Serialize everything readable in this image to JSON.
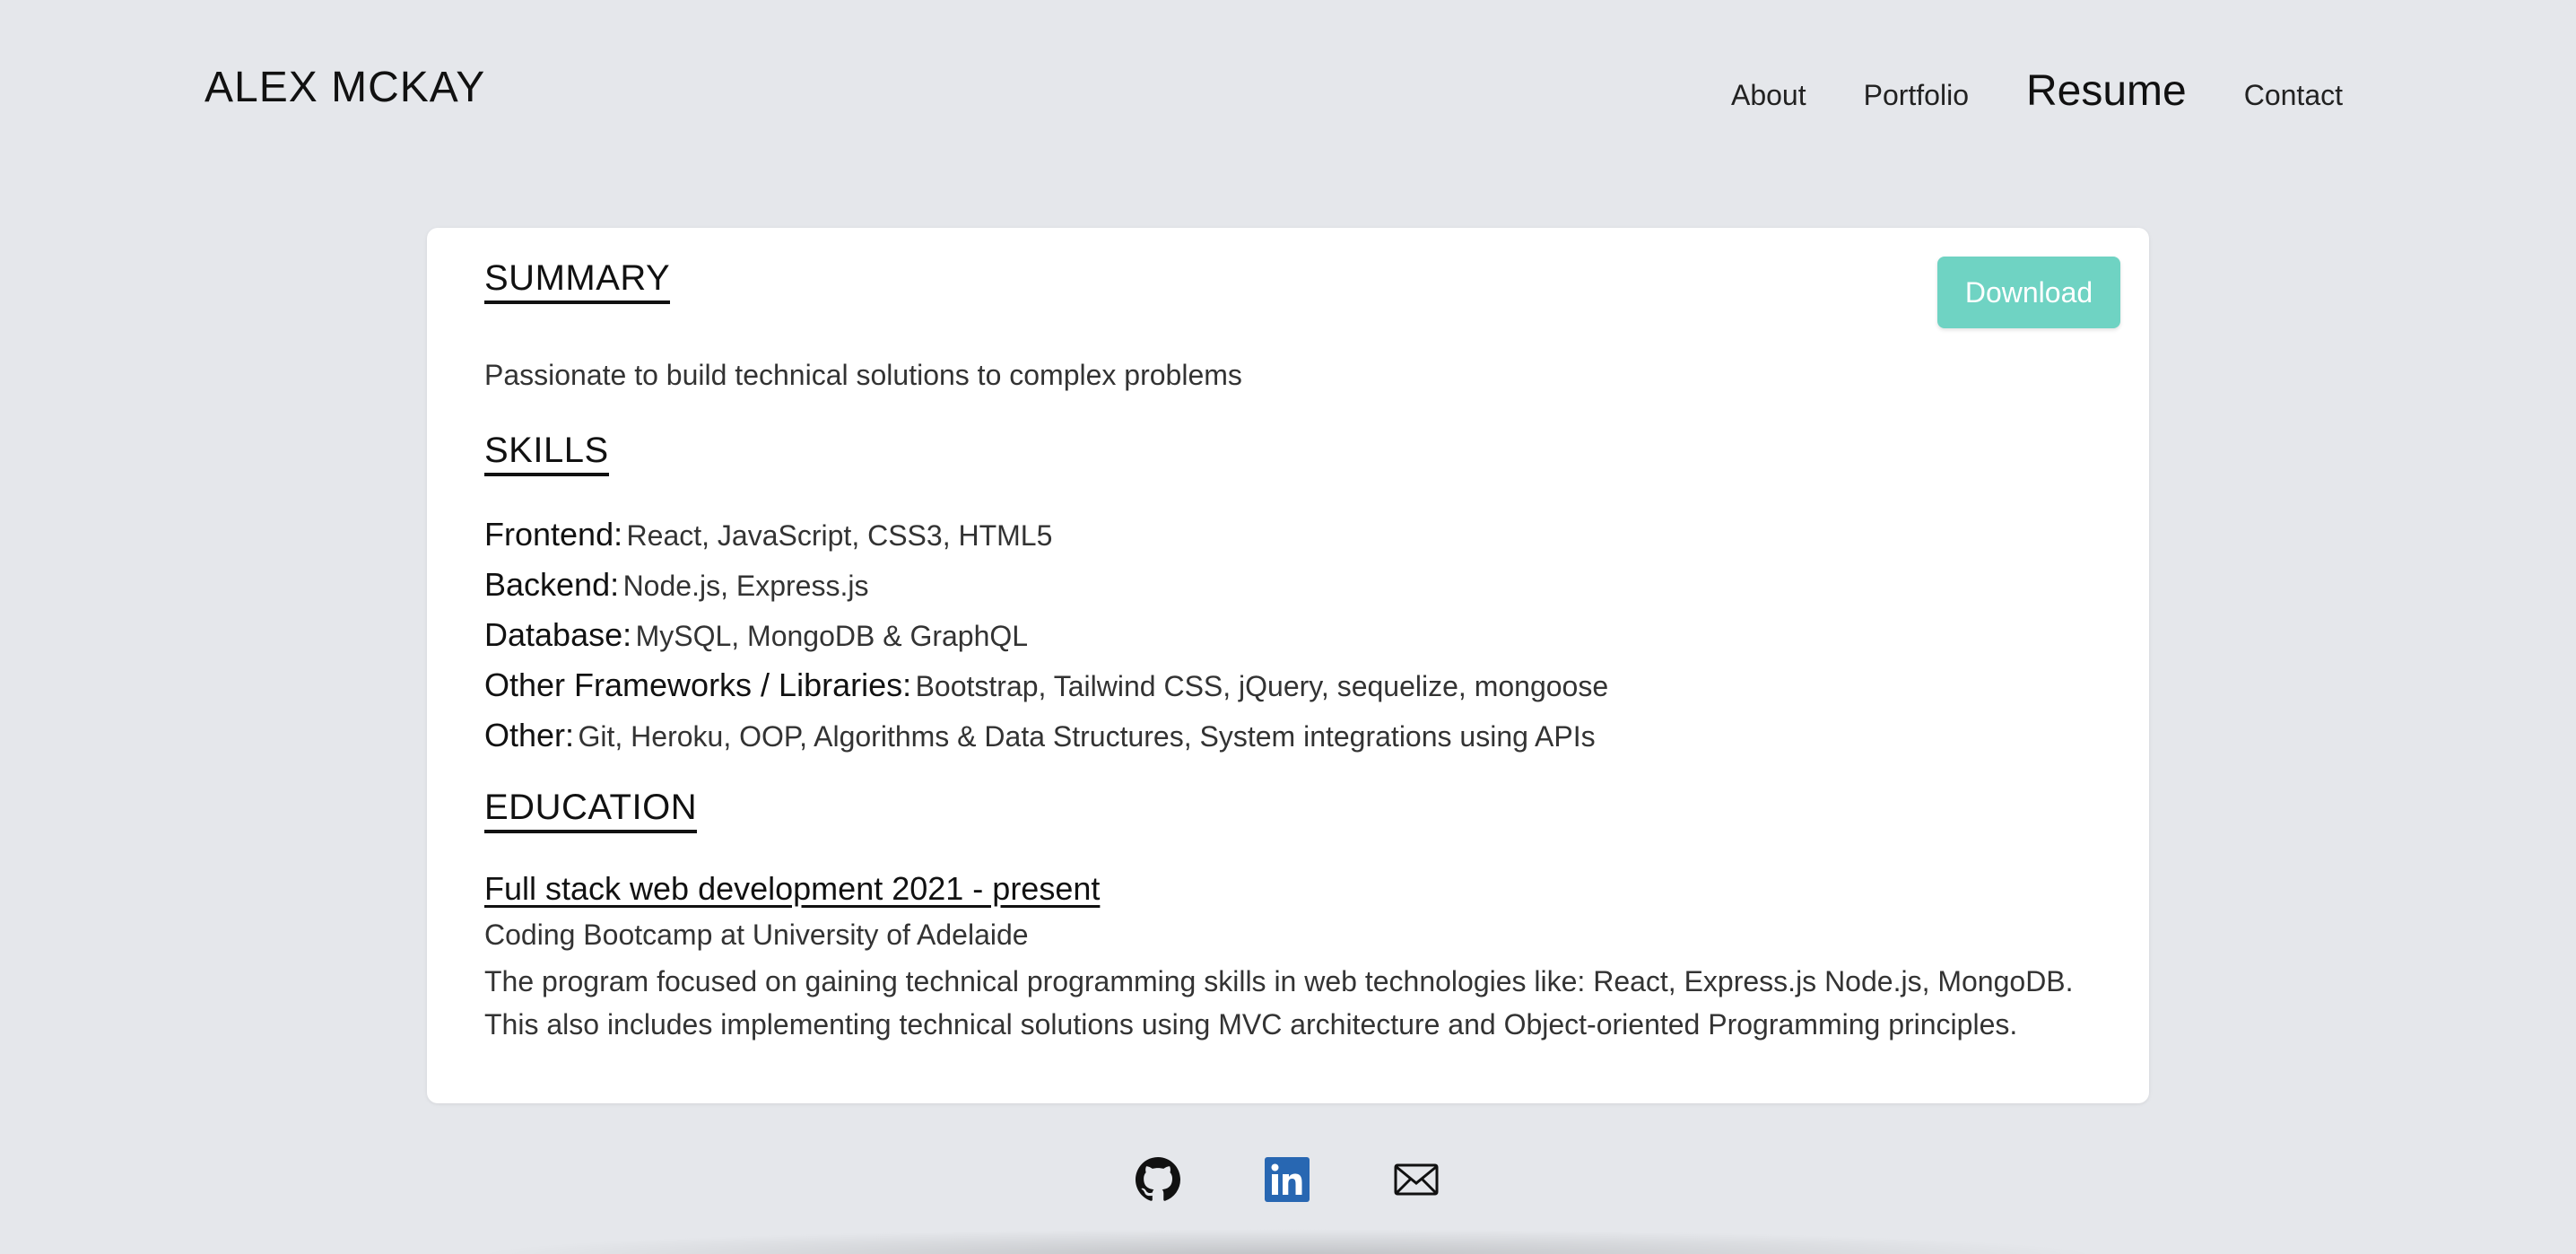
{
  "header": {
    "brand": "ALEX MCKAY",
    "nav": [
      {
        "label": "About",
        "active": false
      },
      {
        "label": "Portfolio",
        "active": false
      },
      {
        "label": "Resume",
        "active": true
      },
      {
        "label": "Contact",
        "active": false
      }
    ]
  },
  "resume": {
    "download_label": "Download",
    "summary": {
      "title": "SUMMARY",
      "text": "Passionate to build technical solutions to complex problems"
    },
    "skills": {
      "title": "SKILLS",
      "items": [
        {
          "label": "Frontend:",
          "value": "React, JavaScript, CSS3, HTML5"
        },
        {
          "label": "Backend:",
          "value": "Node.js, Express.js"
        },
        {
          "label": "Database:",
          "value": "MySQL, MongoDB & GraphQL"
        },
        {
          "label": "Other Frameworks / Libraries:",
          "value": "Bootstrap, Tailwind CSS, jQuery, sequelize, mongoose"
        },
        {
          "label": "Other:",
          "value": "Git, Heroku, OOP, Algorithms & Data Structures, System integrations using APIs"
        }
      ]
    },
    "education": {
      "title": "EDUCATION",
      "heading": "Full stack web development 2021 - present",
      "school": "Coding Bootcamp at University of Adelaide",
      "description": "The program focused on gaining technical programming skills in web technologies like: React, Express.js Node.js, MongoDB. This also includes implementing technical solutions using MVC architecture and Object-oriented Programming principles."
    }
  },
  "footer": {
    "icons": [
      "github-icon",
      "linkedin-icon",
      "email-icon"
    ]
  },
  "colors": {
    "background": "#e5e7eb",
    "card": "#ffffff",
    "accent": "#6fd3c3",
    "linkedin": "#2867b2"
  }
}
